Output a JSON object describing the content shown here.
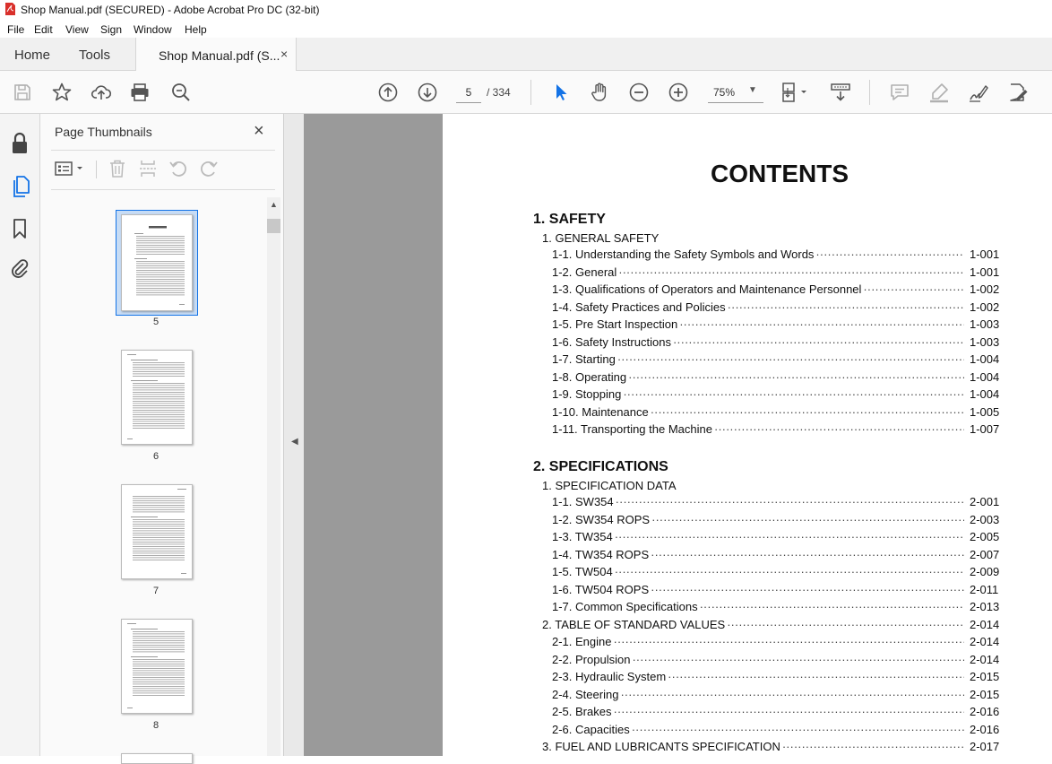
{
  "window": {
    "title": "Shop Manual.pdf (SECURED) - Adobe Acrobat Pro DC (32-bit)"
  },
  "menu": [
    "File",
    "Edit",
    "View",
    "Sign",
    "Window",
    "Help"
  ],
  "tabs": {
    "home": "Home",
    "tools": "Tools",
    "document": "Shop Manual.pdf (S...",
    "document_close": "×"
  },
  "toolbar": {
    "current_page": "5",
    "page_total": "/ 334",
    "zoom": "75%"
  },
  "thumbnails_panel": {
    "title": "Page Thumbnails",
    "close": "×",
    "pages": [
      "5",
      "6",
      "7",
      "8"
    ]
  },
  "document": {
    "heading": "CONTENTS",
    "sections": [
      {
        "title": "1. SAFETY",
        "groups": [
          {
            "title": "1. GENERAL SAFETY",
            "entries": [
              {
                "label": "1-1. Understanding the Safety Symbols and Words",
                "page": "1-001"
              },
              {
                "label": "1-2. General",
                "page": "1-001"
              },
              {
                "label": "1-3. Qualifications of Operators and Maintenance Personnel",
                "page": "1-002"
              },
              {
                "label": "1-4. Safety Practices and Policies",
                "page": "1-002"
              },
              {
                "label": "1-5. Pre Start Inspection",
                "page": "1-003"
              },
              {
                "label": "1-6. Safety Instructions",
                "page": "1-003"
              },
              {
                "label": "1-7. Starting",
                "page": "1-004"
              },
              {
                "label": "1-8. Operating",
                "page": "1-004"
              },
              {
                "label": "1-9. Stopping",
                "page": "1-004"
              },
              {
                "label": "1-10. Maintenance",
                "page": "1-005"
              },
              {
                "label": "1-11. Transporting the Machine",
                "page": "1-007"
              }
            ]
          }
        ]
      },
      {
        "title": "2. SPECIFICATIONS",
        "groups": [
          {
            "title": "1. SPECIFICATION DATA",
            "entries": [
              {
                "label": "1-1. SW354",
                "page": "2-001"
              },
              {
                "label": "1-2. SW354 ROPS",
                "page": "2-003"
              },
              {
                "label": "1-3. TW354",
                "page": "2-005"
              },
              {
                "label": "1-4. TW354 ROPS",
                "page": "2-007"
              },
              {
                "label": "1-5. TW504",
                "page": "2-009"
              },
              {
                "label": "1-6. TW504 ROPS",
                "page": "2-011"
              },
              {
                "label": "1-7. Common Specifications",
                "page": "2-013"
              }
            ]
          },
          {
            "title": "2. TABLE OF STANDARD VALUES",
            "page": "2-014",
            "entries": [
              {
                "label": "2-1. Engine",
                "page": "2-014"
              },
              {
                "label": "2-2. Propulsion",
                "page": "2-014"
              },
              {
                "label": "2-3. Hydraulic System",
                "page": "2-015"
              },
              {
                "label": "2-4. Steering",
                "page": "2-015"
              },
              {
                "label": "2-5. Brakes",
                "page": "2-016"
              },
              {
                "label": "2-6. Capacities",
                "page": "2-016"
              }
            ]
          },
          {
            "title": "3. FUEL AND LUBRICANTS SPECIFICATION",
            "page": "2-017",
            "entries": []
          }
        ]
      }
    ]
  }
}
